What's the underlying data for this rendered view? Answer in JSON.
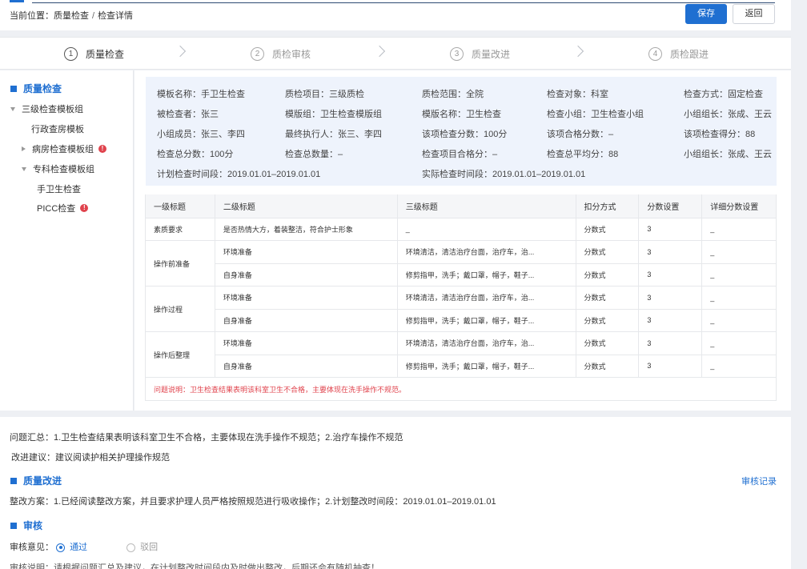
{
  "breadcrumb": {
    "prefix": "当前位置：",
    "level1": "质量检查",
    "sep": "/",
    "level2": "检查详情"
  },
  "actions": {
    "save": "保存",
    "back": "返回"
  },
  "steps": [
    {
      "num": "1",
      "label": "质量检查"
    },
    {
      "num": "2",
      "label": "质检审核"
    },
    {
      "num": "3",
      "label": "质量改进"
    },
    {
      "num": "4",
      "label": "质检跟进"
    }
  ],
  "tree": {
    "title": "质量检查",
    "nodes": [
      {
        "label": "三级检查模板组"
      },
      {
        "label": "行政查房模板"
      },
      {
        "label": "病房检查模板组",
        "badge": "!"
      },
      {
        "label": "专科检查模板组"
      },
      {
        "label": "手卫生检查"
      },
      {
        "label": "PICC检查",
        "badge": "!"
      }
    ]
  },
  "info": {
    "template_name": "模板名称：手卫生检查",
    "project": "质检项目：三级质检",
    "scope": "质检范围：全院",
    "target": "检查对象：科室",
    "method": "检查方式：固定检查",
    "examinee": "被检查者：张三",
    "template_group": "模版组：卫生检查模版组",
    "template_name2": "模版名称：卫生检查",
    "group": "检查小组：卫生检查小组",
    "leader1": "小组组长：张成、王云",
    "members": "小组成员：张三、李四",
    "executor": "最终执行人：张三、李四",
    "item_total": "该项检查分数：100分",
    "item_pass": "该项合格分数：–",
    "item_score": "该项检查得分：88",
    "total_score": "检查总分数：100分",
    "total_count": "检查总数量：–",
    "pass_score": "检查项目合格分：–",
    "avg_score": "检查总平均分：88",
    "leader2": "小组组长：张成、王云",
    "plan_time": "计划检查时间段：2019.01.01–2019.01.01",
    "actual_time": "实际检查时间段：2019.01.01–2019.01.01"
  },
  "table": {
    "headers": [
      "一级标题",
      "二级标题",
      "三级标题",
      "扣分方式",
      "分数设置",
      "详细分数设置"
    ],
    "groups": [
      {
        "l1": "素质要求",
        "rows": [
          {
            "l2": "是否热情大方，着装整洁，符合护士形象",
            "l3": "_",
            "method": "分数式",
            "score": "3",
            "detail": "_"
          }
        ]
      },
      {
        "l1": "操作前准备",
        "rows": [
          {
            "l2": "环境准备",
            "l3": "环境清洁，清洁治疗台面，治疗车，治...",
            "method": "分数式",
            "score": "3",
            "detail": "_"
          },
          {
            "l2": "自身准备",
            "l3": "修剪指甲，洗手；戴口罩，帽子，鞋子...",
            "method": "分数式",
            "score": "3",
            "detail": "_"
          }
        ]
      },
      {
        "l1": "操作过程",
        "rows": [
          {
            "l2": "环境准备",
            "l3": "环境清洁，清洁治疗台面，治疗车，治...",
            "method": "分数式",
            "score": "3",
            "detail": "_"
          },
          {
            "l2": "自身准备",
            "l3": "修剪指甲，洗手；戴口罩，帽子，鞋子...",
            "method": "分数式",
            "score": "3",
            "detail": "_"
          }
        ]
      },
      {
        "l1": "操作后整理",
        "rows": [
          {
            "l2": "环境准备",
            "l3": "环境清洁，清洁治疗台面，治疗车，治...",
            "method": "分数式",
            "score": "3",
            "detail": "_"
          },
          {
            "l2": "自身准备",
            "l3": "修剪指甲，洗手；戴口罩，帽子，鞋子...",
            "method": "分数式",
            "score": "3",
            "detail": "_"
          }
        ]
      }
    ],
    "note": "问题说明：卫生检查结果表明该科室卫生不合格，主要体现在洗手操作不规范。"
  },
  "summary": {
    "issues": "问题汇总：1.卫生检查结果表明该科室卫生不合格，主要体现在洗手操作不规范；2.治疗车操作不规范",
    "advice": "改进建议：建议阅读护相关护理操作规范"
  },
  "improve": {
    "title": "质量改进",
    "record_link": "审核记录",
    "plan": "整改方案：1.已经阅读整改方案，并且要求护理人员严格按照规范进行吸收操作；2.计划整改时间段：2019.01.01–2019.01.01"
  },
  "audit": {
    "title": "审核",
    "opinion_label": "审核意见：",
    "opt_pass": "通过",
    "opt_reject": "驳回",
    "note_cut": "审核说明：请根据问题汇总及建议，在计划整改时间段内及时做出整改，后期还会有随机抽查！"
  }
}
